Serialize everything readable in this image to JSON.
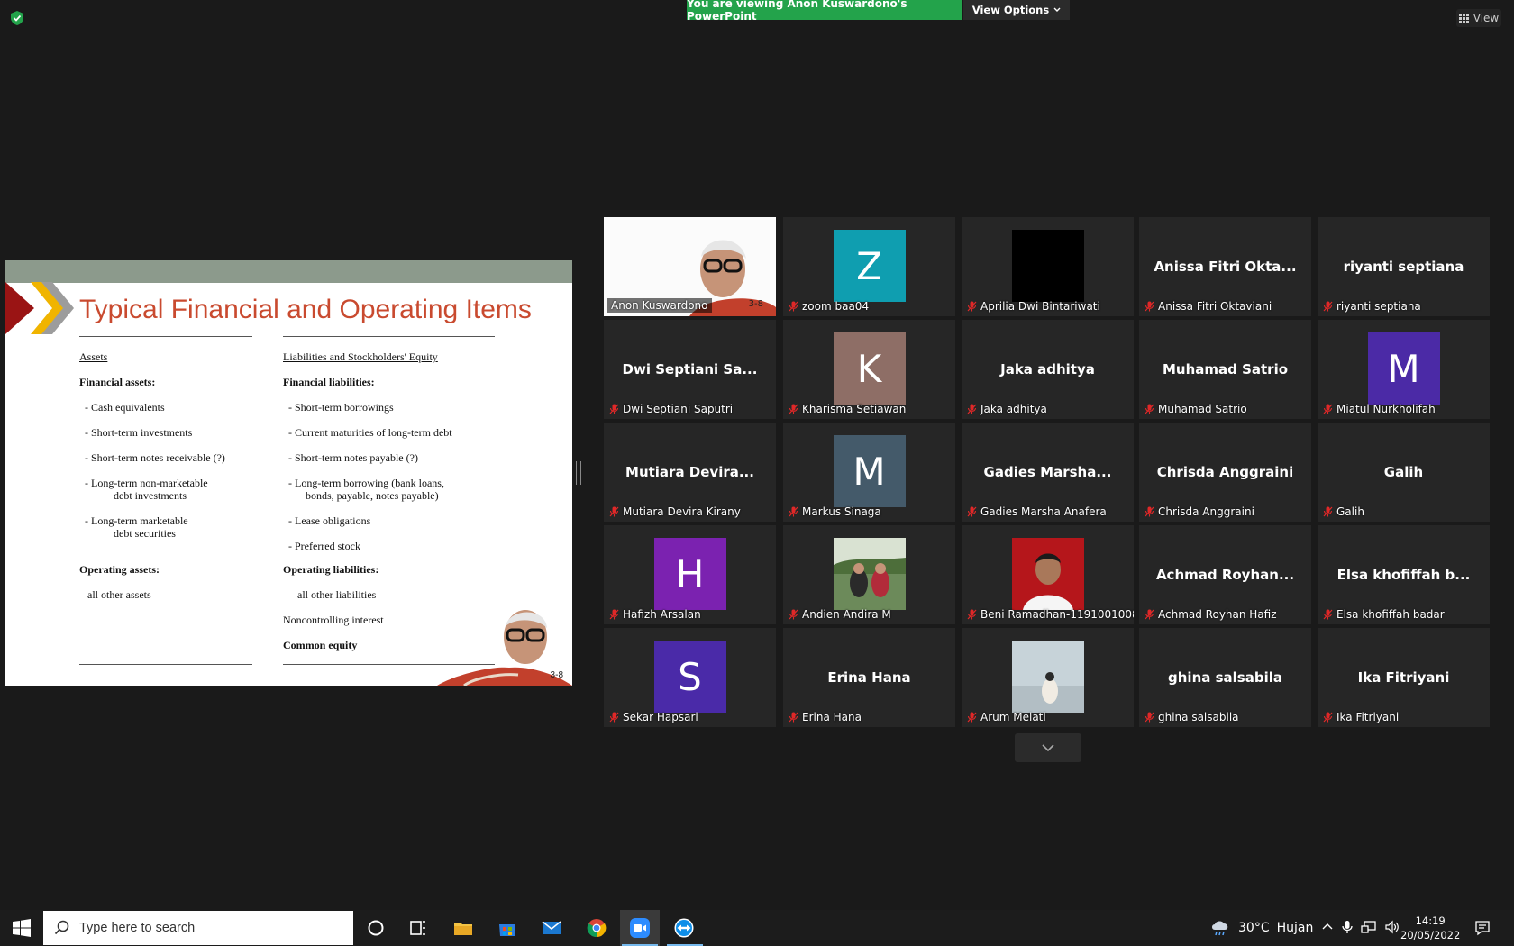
{
  "banner": {
    "viewing": "You are viewing Anon Kuswardono's PowerPoint",
    "view_options": "View Options",
    "view": "View"
  },
  "slide": {
    "title": "Typical Financial and Operating Items",
    "left_col": {
      "header": "Assets",
      "fin_header": "Financial assets:",
      "fin_items": [
        "- Cash equivalents",
        "- Short-term investments",
        "- Short-term notes receivable (?)",
        "- Long-term non-marketable",
        "debt investments",
        "- Long-term marketable",
        "debt securities"
      ],
      "op_header": "Operating assets:",
      "op_item": "all other assets"
    },
    "right_col": {
      "header": "Liabilities and Stockholders' Equity",
      "fin_header": "Financial liabilities:",
      "fin_items": [
        "- Short-term borrowings",
        "- Current maturities of long-term debt",
        "- Short-term notes payable (?)",
        "- Long-term borrowing (bank loans,",
        "bonds, payable, notes payable)",
        "- Lease obligations",
        "- Preferred stock"
      ],
      "op_header": "Operating liabilities:",
      "op_item": "all other liabilities",
      "nci": "Noncontrolling interest",
      "ce": "Common equity"
    },
    "slide_number": "3-8"
  },
  "participants": [
    {
      "name": "Anon Kuswardono",
      "big": "",
      "avatar": "",
      "color": "",
      "type": "active",
      "corner": "3-8"
    },
    {
      "name": "zoom baa04",
      "big": "",
      "avatar": "Z",
      "color": "#0f9eb0",
      "type": "letter"
    },
    {
      "name": "Aprilia Dwi Bintariwati",
      "big": "",
      "avatar": "",
      "color": "#000000",
      "type": "black"
    },
    {
      "name": "Anissa Fitri Oktaviani",
      "big": "Anissa Fitri Okta...",
      "avatar": "",
      "color": "",
      "type": "text"
    },
    {
      "name": "riyanti septiana",
      "big": "riyanti septiana",
      "avatar": "",
      "color": "",
      "type": "text"
    },
    {
      "name": "Dwi Septiani Saputri",
      "big": "Dwi  Septiani  Sa...",
      "avatar": "",
      "color": "",
      "type": "text"
    },
    {
      "name": "Kharisma Setiawan",
      "big": "",
      "avatar": "K",
      "color": "#8e6e66",
      "type": "letter"
    },
    {
      "name": "Jaka adhitya",
      "big": "Jaka adhitya",
      "avatar": "",
      "color": "",
      "type": "text"
    },
    {
      "name": "Muhamad Satrio",
      "big": "Muhamad Satrio",
      "avatar": "",
      "color": "",
      "type": "text"
    },
    {
      "name": "Miatul Nurkholifah",
      "big": "",
      "avatar": "M",
      "color": "#4b2aa6",
      "type": "letter"
    },
    {
      "name": "Mutiara Devira Kirany",
      "big": "Mutiara  Devira...",
      "avatar": "",
      "color": "",
      "type": "text"
    },
    {
      "name": "Markus Sinaga",
      "big": "",
      "avatar": "M",
      "color": "#445a6a",
      "type": "letter"
    },
    {
      "name": "Gadies Marsha Anafera",
      "big": "Gadies  Marsha...",
      "avatar": "",
      "color": "",
      "type": "text"
    },
    {
      "name": "Chrisda Anggraini",
      "big": "Chrisda Anggraini",
      "avatar": "",
      "color": "",
      "type": "text"
    },
    {
      "name": "Galih",
      "big": "Galih",
      "avatar": "",
      "color": "",
      "type": "text"
    },
    {
      "name": "Hafizh Arsalan",
      "big": "",
      "avatar": "H",
      "color": "#7b22b0",
      "type": "letter"
    },
    {
      "name": "Andien Andira M",
      "big": "",
      "avatar": "",
      "color": "#6c8a5a",
      "type": "photo1"
    },
    {
      "name": "Beni Ramadhan-1191001008",
      "big": "",
      "avatar": "",
      "color": "#b5161b",
      "type": "photo2"
    },
    {
      "name": "Achmad Royhan Hafiz",
      "big": "Achmad  Royhan...",
      "avatar": "",
      "color": "",
      "type": "text"
    },
    {
      "name": "Elsa khofiffah badar",
      "big": "Elsa  khofiffah  b...",
      "avatar": "",
      "color": "",
      "type": "text"
    },
    {
      "name": "Sekar Hapsari",
      "big": "",
      "avatar": "S",
      "color": "#4a2aa8",
      "type": "letter"
    },
    {
      "name": "Erina Hana",
      "big": "Erina Hana",
      "avatar": "",
      "color": "",
      "type": "text"
    },
    {
      "name": "Arum Melati",
      "big": "",
      "avatar": "",
      "color": "#c7d3d9",
      "type": "photo3"
    },
    {
      "name": "ghina salsabila",
      "big": "ghina salsabila",
      "avatar": "",
      "color": "",
      "type": "text"
    },
    {
      "name": "Ika Fitriyani",
      "big": "Ika Fitriyani",
      "avatar": "",
      "color": "",
      "type": "text"
    }
  ],
  "taskbar": {
    "search_placeholder": "Type here to search",
    "temperature": "30°C",
    "weather": "Hujan",
    "time": "14:19",
    "date": "20/05/2022"
  }
}
